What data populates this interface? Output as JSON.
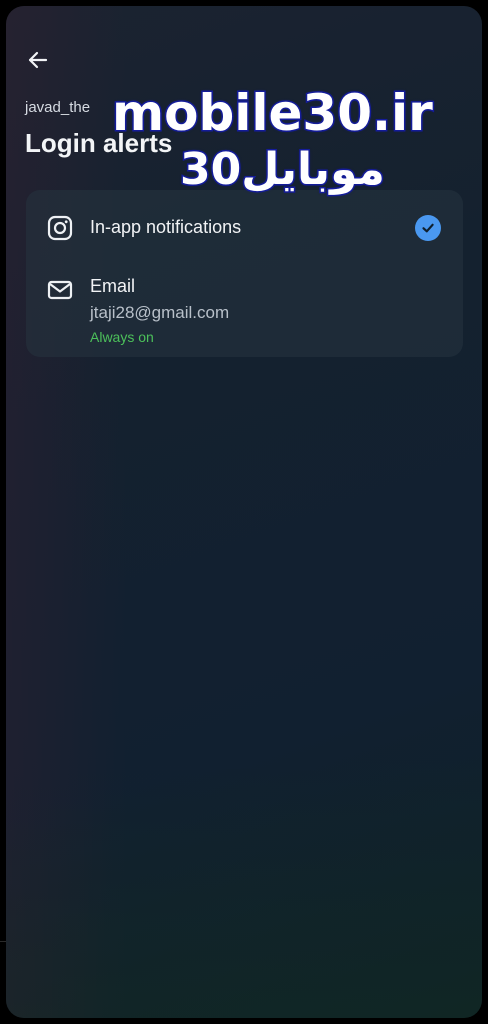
{
  "header": {
    "back_icon": "arrow-left-icon",
    "username": "javad_the",
    "title": "Login alerts"
  },
  "alerts": {
    "items": [
      {
        "icon": "instagram-icon",
        "label": "In-app notifications",
        "selected": true
      },
      {
        "icon": "mail-icon",
        "label": "Email",
        "address": "jtaji28@gmail.com",
        "status": "Always on"
      }
    ]
  },
  "watermark": {
    "line1": "mobile30.ir",
    "line2": "موبایل30"
  },
  "colors": {
    "accent": "#4a98f0",
    "status_green": "#4cc05a",
    "watermark_stroke": "#151d9a"
  }
}
